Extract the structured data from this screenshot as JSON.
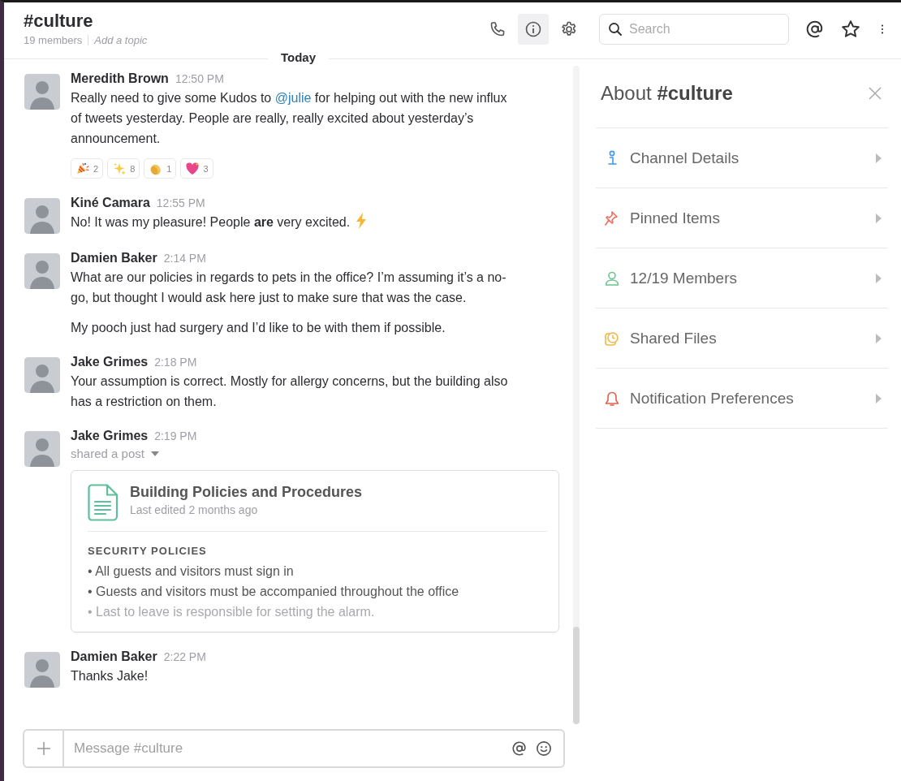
{
  "channel": {
    "name": "#culture",
    "members": "19 members",
    "topic_placeholder": "Add a topic"
  },
  "header_buttons": [
    {
      "kind": "call",
      "selected": false
    },
    {
      "kind": "info",
      "selected": true
    },
    {
      "kind": "settings",
      "selected": false
    }
  ],
  "search": {
    "placeholder": "Search"
  },
  "header_actions": [
    {
      "kind": "mentions"
    },
    {
      "kind": "star"
    },
    {
      "kind": "more"
    }
  ],
  "day_divider": "Today",
  "messages": [
    {
      "author": "Meredith Brown",
      "time": "12:50 PM",
      "paragraphs": [
        [
          {
            "kind": "text",
            "text": "Really need to give some Kudos to "
          },
          {
            "kind": "mention",
            "text": "@julie"
          },
          {
            "kind": "text",
            "text": " for helping out with the new influx of tweets yesterday. People are really, really excited about yesterday’s announcement."
          }
        ]
      ],
      "reactions": [
        {
          "kind": "party",
          "count": "2"
        },
        {
          "kind": "sparkles",
          "count": "8"
        },
        {
          "kind": "clap",
          "count": "1"
        },
        {
          "kind": "heart",
          "count": "3"
        }
      ]
    },
    {
      "author": "Kiné Camara",
      "time": "12:55 PM",
      "paragraphs": [
        [
          {
            "kind": "text",
            "text": "No! It was my pleasure! People **are** very excited. "
          },
          {
            "kind": "lightning"
          }
        ]
      ]
    },
    {
      "author": "Damien Baker",
      "time": "2:14 PM",
      "paragraphs": [
        [
          {
            "kind": "text",
            "text": "What are our policies in regards to pets in the office? I’m assuming it’s a no-go, but thought I would ask here just to make sure that was the case."
          }
        ],
        [
          {
            "kind": "text",
            "text": "My pooch just had surgery and I’d like to be with them if possible."
          }
        ]
      ]
    },
    {
      "author": "Jake Grimes",
      "time": "2:18 PM",
      "paragraphs": [
        [
          {
            "kind": "text",
            "text": "Your assumption is correct. Mostly for allergy concerns, but the building also has a restriction on them."
          }
        ]
      ]
    },
    {
      "author": "Jake Grimes",
      "time": "2:19 PM",
      "action": "shared a post",
      "post": {
        "title": "Building Policies and Procedures",
        "subtitle": "Last edited 2 months ago",
        "section": "SECURITY POLICIES",
        "bullets": [
          {
            "text": "• All guests and visitors must sign in",
            "faded": false
          },
          {
            "text": "• Guests and visitors must be accompanied throughout the office",
            "faded": false
          },
          {
            "text": "• Last to leave is responsible for setting the alarm.",
            "faded": true
          }
        ]
      }
    },
    {
      "author": "Damien Baker",
      "time": "2:22 PM",
      "paragraphs": [
        [
          {
            "kind": "text",
            "text": "Thanks Jake!"
          }
        ]
      ]
    }
  ],
  "composer": {
    "placeholder": "Message #culture"
  },
  "details_panel": {
    "title": "About **#culture**",
    "items": [
      {
        "kind": "info",
        "label": "Channel Details"
      },
      {
        "kind": "pin",
        "label": "Pinned Items"
      },
      {
        "kind": "members",
        "label": "12/19 Members"
      },
      {
        "kind": "files",
        "label": "Shared Files"
      },
      {
        "kind": "bell",
        "label": "Notification Preferences"
      }
    ]
  }
}
